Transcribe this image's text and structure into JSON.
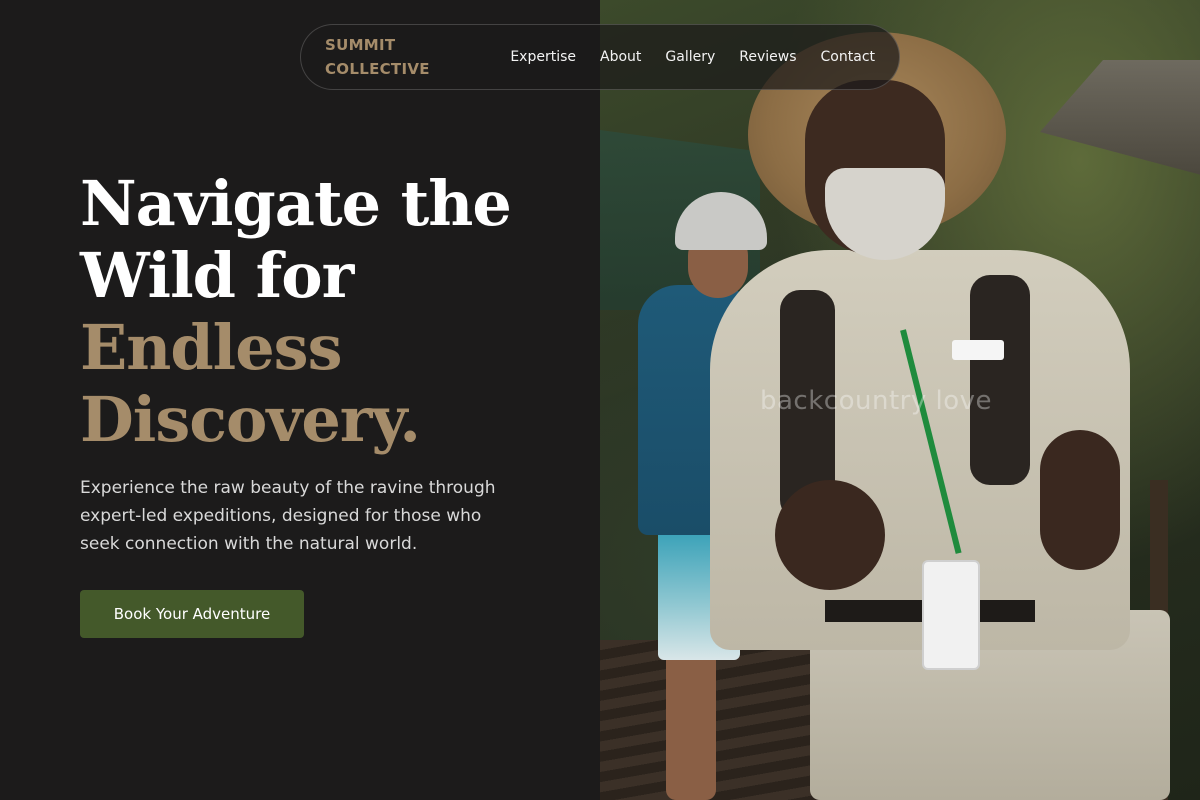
{
  "nav": {
    "brand_line1": "SUMMIT",
    "brand_line2": "COLLECTIVE",
    "links": [
      {
        "label": "Expertise"
      },
      {
        "label": "About"
      },
      {
        "label": "Gallery"
      },
      {
        "label": "Reviews"
      },
      {
        "label": "Contact"
      }
    ]
  },
  "hero": {
    "title_line1": "Navigate the",
    "title_line2": "Wild for",
    "title_accent_line1": "Endless",
    "title_accent_line2": "Discovery.",
    "description": "Experience the raw beauty of the ravine through expert-led expeditions, designed for those who seek connection with the natural world.",
    "cta_label": "Book Your Adventure"
  },
  "photo": {
    "watermark": "backcountry love"
  },
  "colors": {
    "background": "#1c1b1b",
    "brand_accent": "#a58c6a",
    "cta_green": "#44592a",
    "text_light": "#ffffff"
  },
  "icons": []
}
